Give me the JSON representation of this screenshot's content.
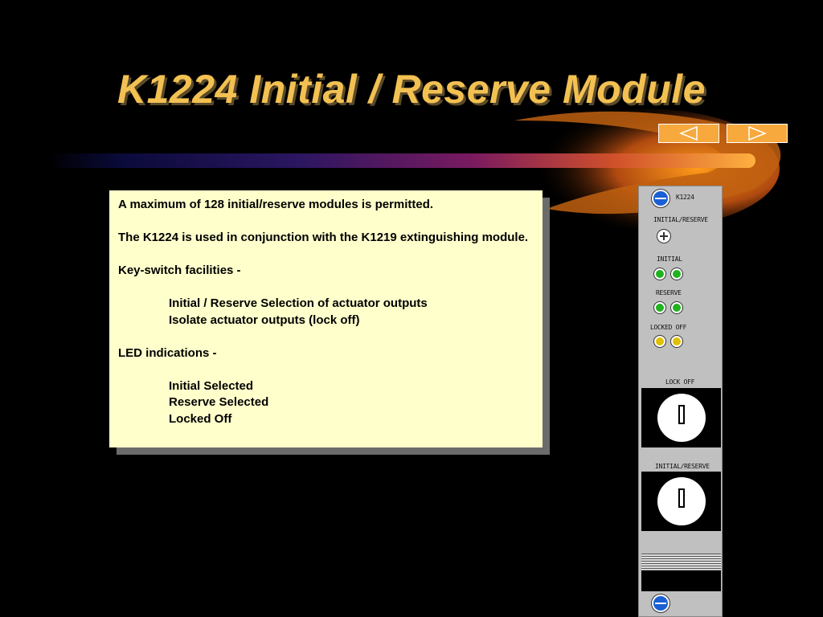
{
  "slide": {
    "title": "K1224 Initial / Reserve Module"
  },
  "nav": {
    "prev_icon": "left-triangle-icon",
    "next_icon": "right-triangle-icon",
    "button_color": "#f7a93e"
  },
  "content": {
    "line1": "A maximum of 128 initial/reserve modules is permitted.",
    "line2": "The K1224 is used in conjunction with the K1219 extinguishing module.",
    "line3": "Key-switch facilities -",
    "line4": "Initial / Reserve Selection of actuator outputs",
    "line5": "Isolate actuator outputs (lock off)",
    "line6": "LED indications -",
    "line7": "Initial Selected",
    "line8": "Reserve Selected",
    "line9": "Locked Off",
    "background_color": "#ffffcc"
  },
  "module_panel": {
    "model_label": "K1224",
    "top_label": "INITIAL/RESERVE",
    "initial_label": "INITIAL",
    "reserve_label": "RESERVE",
    "locked_off_label": "LOCKED OFF",
    "lock_off_label": "LOCK OFF",
    "key_label": "INITIAL/RESERVE"
  },
  "colors": {
    "title": "#f3c152",
    "led_green": "#1fb31f",
    "led_yellow": "#e0c000",
    "screw_blue": "#1a5fd4"
  }
}
